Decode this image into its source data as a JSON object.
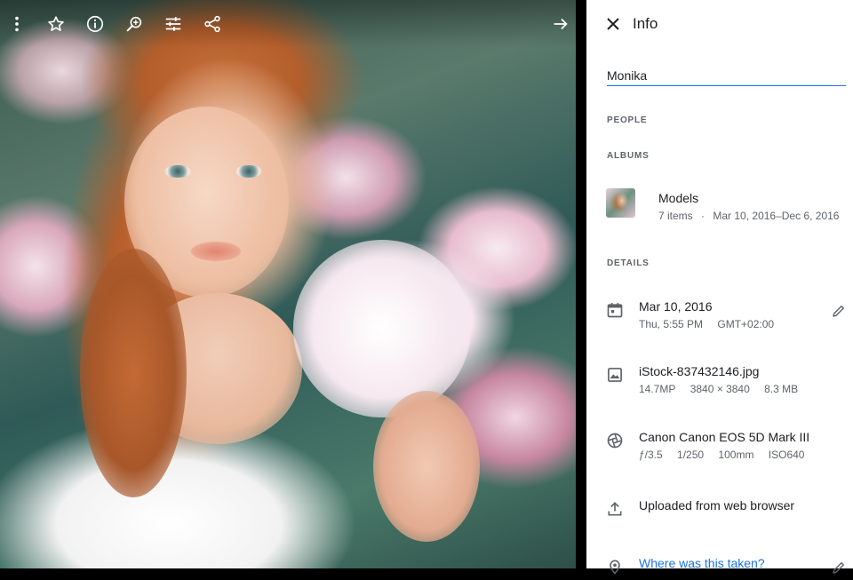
{
  "toolbar": {
    "icons": [
      "more-vert-icon",
      "star-icon",
      "info-icon",
      "zoom-icon",
      "tune-icon",
      "share-icon",
      "arrow-forward-icon"
    ]
  },
  "info_panel": {
    "title": "Info",
    "description_value": "Monika",
    "sections": {
      "people": "PEOPLE",
      "albums": "ALBUMS",
      "details": "DETAILS"
    },
    "album": {
      "name": "Models",
      "count": "7 items",
      "separator": "·",
      "date_range": "Mar 10, 2016–Dec 6, 2016"
    },
    "details": {
      "date": {
        "main": "Mar 10, 2016",
        "time": "Thu, 5:55 PM",
        "timezone": "GMT+02:00"
      },
      "file": {
        "name": "iStock-837432146.jpg",
        "megapixels": "14.7MP",
        "resolution": "3840 × 3840",
        "size": "8.3 MB"
      },
      "camera": {
        "model": "Canon Canon EOS 5D Mark III",
        "aperture": "ƒ/3.5",
        "shutter": "1/250",
        "focal_length": "100mm",
        "iso": "ISO640"
      },
      "upload": {
        "text": "Uploaded from web browser"
      },
      "location": {
        "link": "Where was this taken?"
      }
    }
  },
  "colors": {
    "accent": "#1a73e8",
    "text_primary": "#202124",
    "text_secondary": "#5f6368",
    "background": "#000000"
  }
}
